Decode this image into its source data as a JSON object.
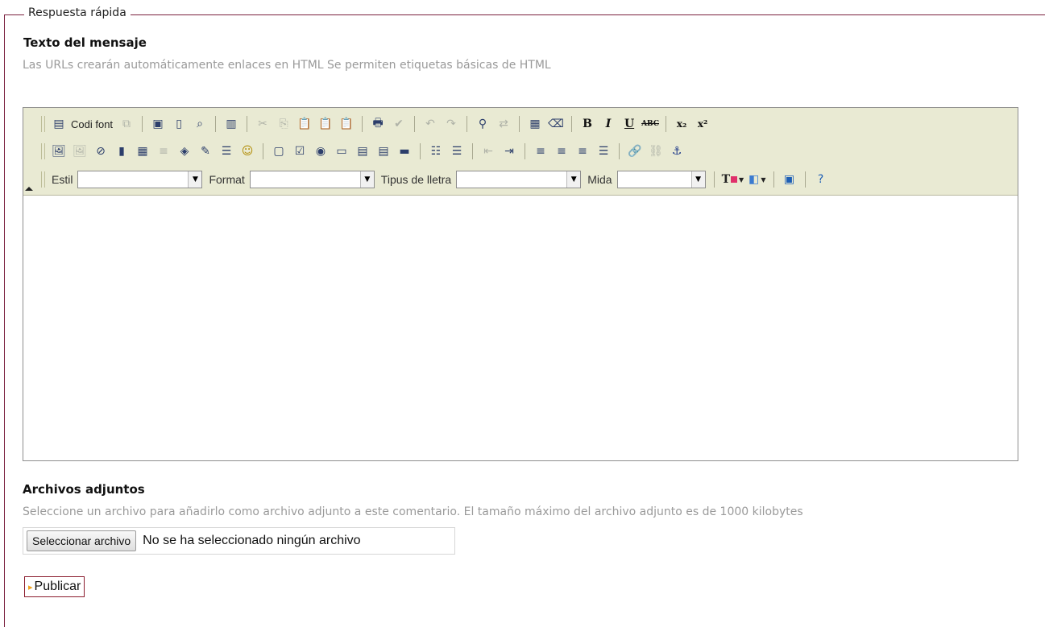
{
  "fieldset": {
    "legend": "Respuesta rápida"
  },
  "message": {
    "label": "Texto del mensaje",
    "hint": "Las URLs crearán automáticamente enlaces en HTML Se permiten etiquetas básicas de HTML"
  },
  "editor": {
    "source_label": "Codi font",
    "style_label": "Estil",
    "style_value": "",
    "format_label": "Format",
    "format_value": "",
    "font_label": "Tipus de lletra",
    "font_value": "",
    "size_label": "Mida",
    "size_value": "",
    "content": ""
  },
  "attachments": {
    "label": "Archivos adjuntos",
    "hint": "Seleccione un archivo para añadirlo como archivo adjunto a este comentario. El tamaño máximo del archivo adjunto es de 1000 kilobytes",
    "button_label": "Seleccionar archivo",
    "status": "No se ha seleccionado ningún archivo"
  },
  "submit": {
    "label": "Publicar"
  },
  "colors": {
    "frame": "#7a1f3d",
    "toolbar_bg": "#e9ead3",
    "hint": "#9a9a9a",
    "publish_border": "#8b1c2e"
  }
}
